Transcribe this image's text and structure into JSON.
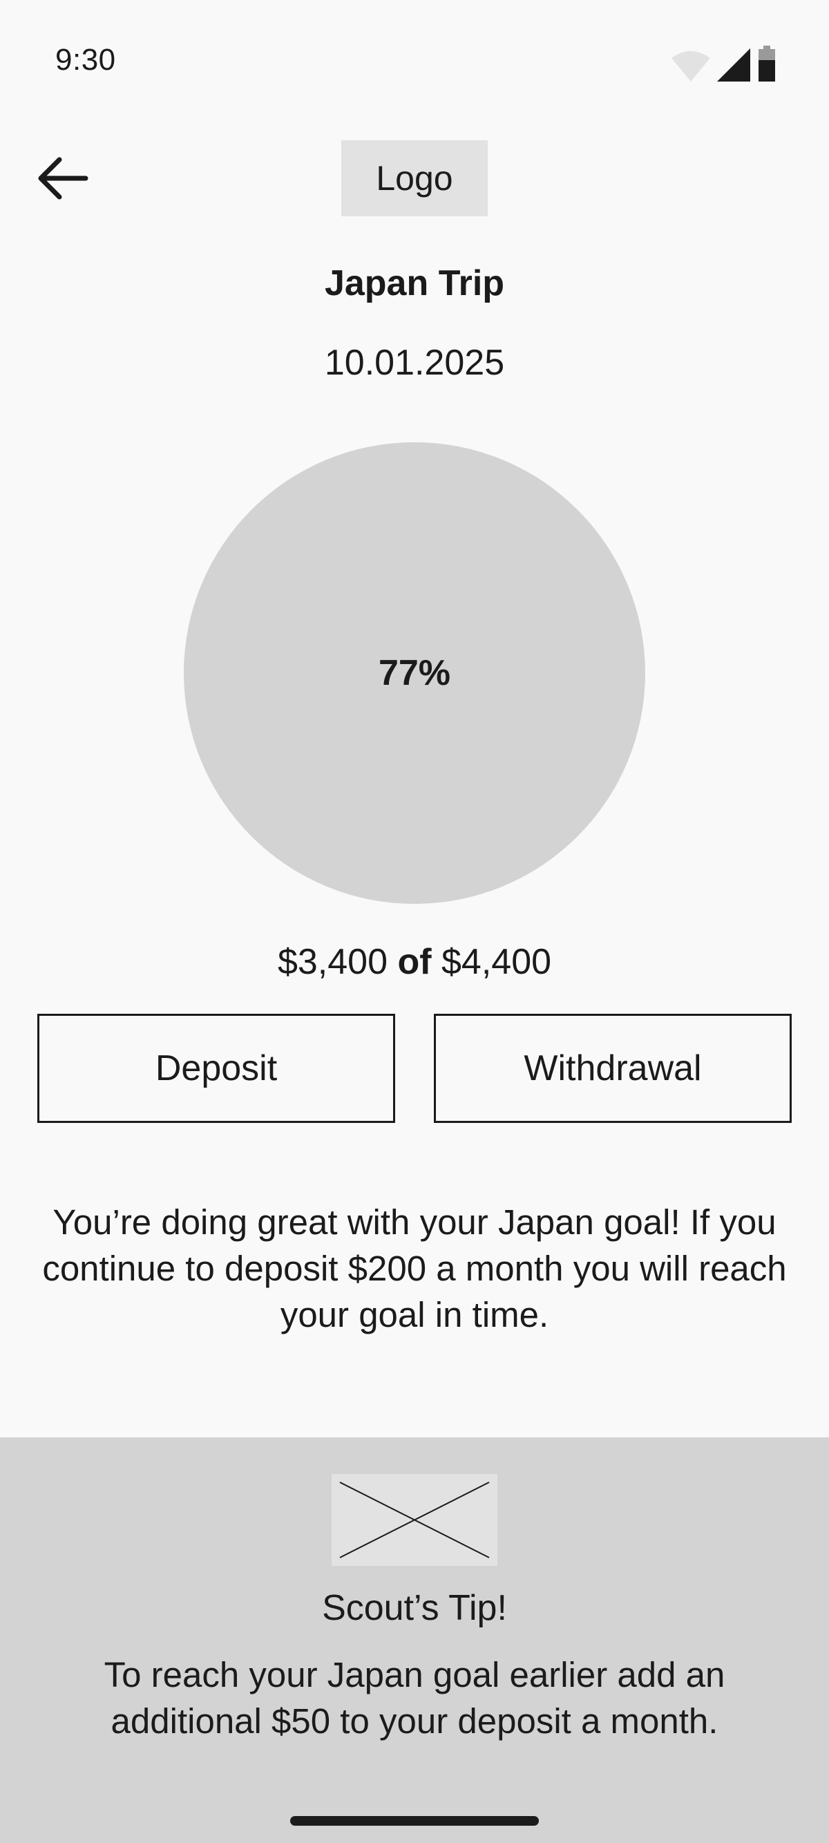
{
  "status_bar": {
    "time": "9:30",
    "icons": [
      "wifi-icon",
      "cellular-signal-icon",
      "battery-icon"
    ]
  },
  "app_bar": {
    "back_icon": "arrow-left-icon",
    "logo_text": "Logo"
  },
  "goal": {
    "title": "Japan Trip",
    "date": "10.01.2025",
    "progress_text": "77%",
    "progress_fraction": 0.77,
    "amount_saved": "$3,400",
    "amount_of": "of",
    "amount_target": "$4,400"
  },
  "actions": {
    "deposit_label": "Deposit",
    "withdrawal_label": "Withdrawal"
  },
  "encouragement": {
    "message": "You’re doing great with your Japan goal! If you continue to deposit $200 a month you will reach your goal in time."
  },
  "tip": {
    "image_icon": "image-placeholder-icon",
    "title": "Scout’s Tip!",
    "text": "To reach your Japan goal earlier add an additional $50 to your deposit a month."
  },
  "colors": {
    "background": "#f9f9f9",
    "circle": "#d3d3d3",
    "panel": "#d3d3d3",
    "placeholder": "#e2e2e2",
    "text": "#1b1b1b"
  }
}
